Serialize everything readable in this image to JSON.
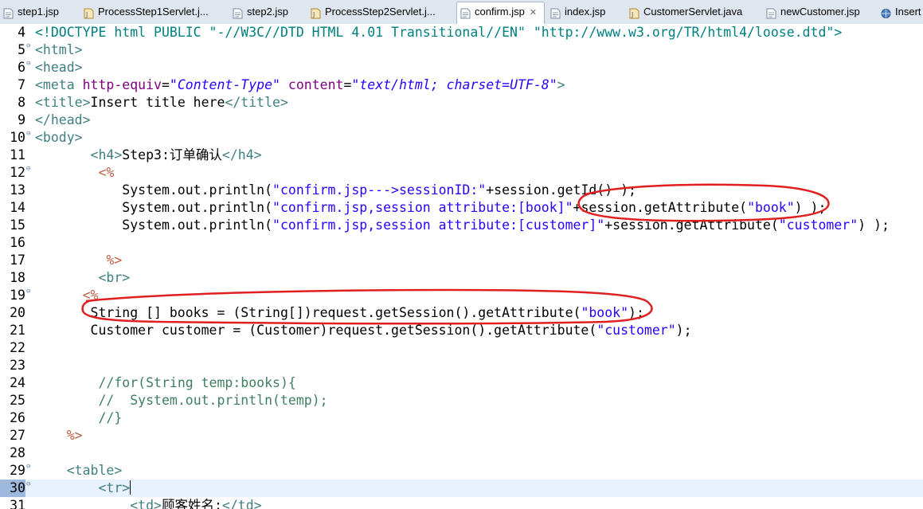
{
  "tabs": [
    {
      "label": "step1.jsp",
      "icon": "jsp-file-icon",
      "active": false
    },
    {
      "label": "ProcessStep1Servlet.j...",
      "icon": "java-file-icon",
      "active": false
    },
    {
      "label": "step2.jsp",
      "icon": "jsp-file-icon",
      "active": false
    },
    {
      "label": "ProcessStep2Servlet.j...",
      "icon": "java-file-icon",
      "active": false
    },
    {
      "label": "confirm.jsp",
      "icon": "jsp-file-icon",
      "active": true,
      "close": "✕"
    },
    {
      "label": "index.jsp",
      "icon": "jsp-file-icon",
      "active": false
    },
    {
      "label": "CustomerServlet.java",
      "icon": "java-file-icon",
      "active": false
    },
    {
      "label": "newCustomer.jsp",
      "icon": "jsp-file-icon",
      "active": false
    },
    {
      "label": "Insert",
      "icon": "globe-icon",
      "active": false
    }
  ],
  "colors": {
    "tag": "#3f7f7f",
    "attribute": "#7f007f",
    "attr_value": "#2a00ff",
    "string": "#2a00ff",
    "jsp_delimiter": "#bf5f3f",
    "comment": "#3f7f5f",
    "annotation": "#e02020",
    "current_line": "#e8f2fe",
    "tab_bar": "#dfe6ef"
  },
  "current_line": 30,
  "lines": [
    {
      "n": "4",
      "fold": "",
      "t": [
        [
          "doc",
          "<!DOCTYPE html PUBLIC \"-//W3C//DTD HTML 4.01 Transitional//EN\" \"http://www.w3.org/TR/html4/loose.dtd\">"
        ]
      ]
    },
    {
      "n": "5",
      "fold": "⊖",
      "t": [
        [
          "tg",
          "<html>"
        ]
      ]
    },
    {
      "n": "6",
      "fold": "⊖",
      "t": [
        [
          "tg",
          "<head>"
        ]
      ]
    },
    {
      "n": "7",
      "fold": "",
      "t": [
        [
          "tg",
          "<meta "
        ],
        [
          "at",
          "http-equiv"
        ],
        [
          "tx",
          "="
        ],
        [
          "av",
          "\"Content-Type\""
        ],
        [
          "tx",
          " "
        ],
        [
          "at",
          "content"
        ],
        [
          "tx",
          "="
        ],
        [
          "av",
          "\"text/html; charset=UTF-8\""
        ],
        [
          "tg",
          ">"
        ]
      ]
    },
    {
      "n": "8",
      "fold": "",
      "t": [
        [
          "tg",
          "<title>"
        ],
        [
          "tx",
          "Insert title here"
        ],
        [
          "tg",
          "</title>"
        ]
      ]
    },
    {
      "n": "9",
      "fold": "",
      "t": [
        [
          "tg",
          "</head>"
        ]
      ]
    },
    {
      "n": "10",
      "fold": "⊖",
      "t": [
        [
          "tg",
          "<body>"
        ]
      ]
    },
    {
      "n": "11",
      "fold": "",
      "t": [
        [
          "tx",
          "       "
        ],
        [
          "tg",
          "<h4>"
        ],
        [
          "tx",
          "Step3:订单确认"
        ],
        [
          "tg",
          "</h4>"
        ]
      ]
    },
    {
      "n": "12",
      "fold": "⊖",
      "t": [
        [
          "tx",
          "        "
        ],
        [
          "dl",
          "<%"
        ]
      ]
    },
    {
      "n": "13",
      "fold": "",
      "t": [
        [
          "tx",
          "           System.out.println("
        ],
        [
          "st",
          "\"confirm.jsp--->sessionID:\""
        ],
        [
          "tx",
          "+session.getId() );"
        ]
      ]
    },
    {
      "n": "14",
      "fold": "",
      "t": [
        [
          "tx",
          "           System.out.println("
        ],
        [
          "st",
          "\"confirm.jsp,session attribute:[book]\""
        ],
        [
          "tx",
          "+session.getAttribute("
        ],
        [
          "st",
          "\"book\""
        ],
        [
          "tx",
          ") );"
        ]
      ]
    },
    {
      "n": "15",
      "fold": "",
      "t": [
        [
          "tx",
          "           System.out.println("
        ],
        [
          "st",
          "\"confirm.jsp,session attribute:[customer]\""
        ],
        [
          "tx",
          "+session.getAttribute("
        ],
        [
          "st",
          "\"customer\""
        ],
        [
          "tx",
          ") );"
        ]
      ]
    },
    {
      "n": "16",
      "fold": "",
      "t": [
        [
          "tx",
          ""
        ]
      ]
    },
    {
      "n": "17",
      "fold": "",
      "t": [
        [
          "tx",
          "         "
        ],
        [
          "dl",
          "%>"
        ]
      ]
    },
    {
      "n": "18",
      "fold": "",
      "t": [
        [
          "tx",
          "        "
        ],
        [
          "tg",
          "<br>"
        ]
      ]
    },
    {
      "n": "19",
      "fold": "⊖",
      "t": [
        [
          "tx",
          "      "
        ],
        [
          "dl",
          "<%"
        ]
      ]
    },
    {
      "n": "20",
      "fold": "",
      "t": [
        [
          "tx",
          "       String [] books = (String[])request.getSession().getAttribute("
        ],
        [
          "st",
          "\"book\""
        ],
        [
          "tx",
          ");"
        ]
      ]
    },
    {
      "n": "21",
      "fold": "",
      "t": [
        [
          "tx",
          "       Customer customer = (Customer)request.getSession().getAttribute("
        ],
        [
          "st",
          "\"customer\""
        ],
        [
          "tx",
          ");"
        ]
      ]
    },
    {
      "n": "22",
      "fold": "",
      "t": [
        [
          "tx",
          ""
        ]
      ]
    },
    {
      "n": "23",
      "fold": "",
      "t": [
        [
          "tx",
          ""
        ]
      ]
    },
    {
      "n": "24",
      "fold": "",
      "t": [
        [
          "tx",
          "        "
        ],
        [
          "cm",
          "//for(String temp:books){"
        ]
      ]
    },
    {
      "n": "25",
      "fold": "",
      "t": [
        [
          "tx",
          "        "
        ],
        [
          "cm",
          "//  System.out.println(temp);"
        ]
      ]
    },
    {
      "n": "26",
      "fold": "",
      "t": [
        [
          "tx",
          "        "
        ],
        [
          "cm",
          "//}"
        ]
      ]
    },
    {
      "n": "27",
      "fold": "",
      "t": [
        [
          "tx",
          "    "
        ],
        [
          "dl",
          "%>"
        ]
      ]
    },
    {
      "n": "28",
      "fold": "",
      "t": [
        [
          "tx",
          ""
        ]
      ]
    },
    {
      "n": "29",
      "fold": "⊖",
      "t": [
        [
          "tx",
          "    "
        ],
        [
          "tg",
          "<table>"
        ]
      ]
    },
    {
      "n": "30",
      "fold": "⊖",
      "t": [
        [
          "tx",
          "        "
        ],
        [
          "tg",
          "<tr>"
        ],
        [
          "caret",
          ""
        ]
      ]
    },
    {
      "n": "31",
      "fold": "",
      "t": [
        [
          "tx",
          "            "
        ],
        [
          "tg",
          "<td>"
        ],
        [
          "tx",
          "顾客姓名:"
        ],
        [
          "tg",
          "</td>"
        ]
      ]
    }
  ]
}
